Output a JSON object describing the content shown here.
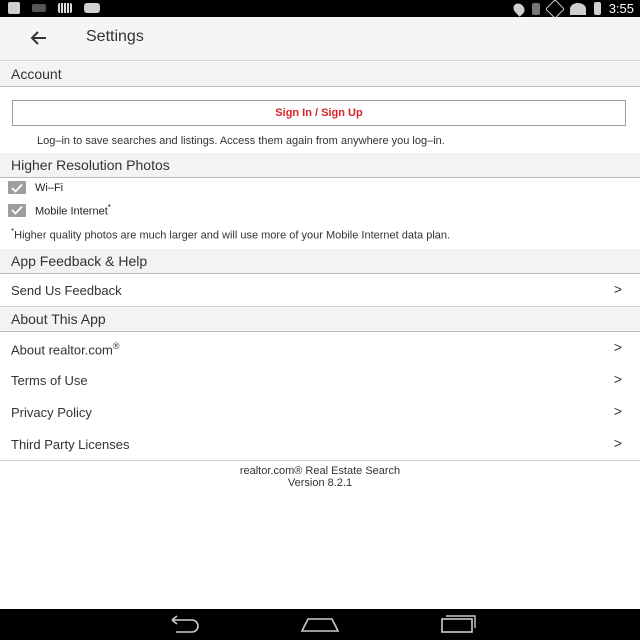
{
  "status_bar": {
    "time": "3:55",
    "left_icons": [
      "download-icon",
      "image-icon",
      "barcode-icon",
      "youtube-icon"
    ],
    "right_icons": [
      "location-icon",
      "bluetooth-icon",
      "mute-icon",
      "wifi-icon",
      "battery-icon"
    ]
  },
  "app_bar": {
    "title": "Settings",
    "back_icon": "back-arrow-icon"
  },
  "account": {
    "header": "Account",
    "signin_label": "Sign In / Sign Up",
    "note": "Log–in to save searches and listings. Access them again from anywhere you log–in.",
    "accent_color": "#d92228"
  },
  "photos": {
    "header": "Higher Resolution Photos",
    "options": [
      {
        "label": "Wi–Fi",
        "checked": true
      },
      {
        "label": "Mobile Internet",
        "sup": "*",
        "checked": true
      }
    ],
    "note_sup": "*",
    "note": "Higher quality photos are much larger and will use more of your Mobile Internet data plan."
  },
  "feedback": {
    "header": "App Feedback & Help",
    "items": [
      {
        "label": "Send Us Feedback"
      }
    ]
  },
  "about": {
    "header": "About This App",
    "items": [
      {
        "label": "About realtor.com",
        "sup": "®"
      },
      {
        "label": "Terms of Use"
      },
      {
        "label": "Privacy Policy"
      },
      {
        "label": "Third Party Licenses"
      }
    ]
  },
  "footer": {
    "app_name": "realtor.com® Real Estate Search",
    "version": "Version 8.2.1"
  },
  "nav_bar": {
    "icons": [
      "back-nav-icon",
      "home-nav-icon",
      "recents-nav-icon"
    ]
  }
}
